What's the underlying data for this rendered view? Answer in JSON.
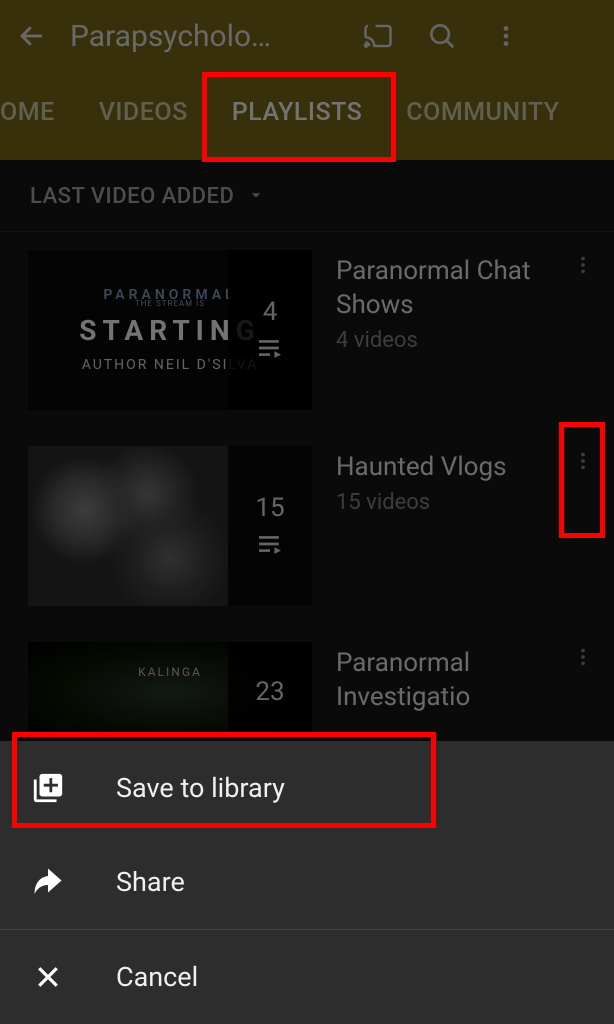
{
  "header": {
    "title": "Parapsycholo…"
  },
  "tabs": {
    "home": "OME",
    "videos": "VIDEOS",
    "playlists": "PLAYLISTS",
    "community": "COMMUNITY"
  },
  "sort": {
    "label": "LAST VIDEO ADDED"
  },
  "playlists": [
    {
      "title": "Paranormal Chat Shows",
      "subtitle": "4 videos",
      "count": "4",
      "thumb_line1": "PARANORMAL",
      "thumb_tiny": "THE STREAM IS",
      "thumb_line2": "STARTING",
      "thumb_line3": "AUTHOR NEIL D'SILVA"
    },
    {
      "title": "Haunted Vlogs",
      "subtitle": "15 videos",
      "count": "15"
    },
    {
      "title": "Paranormal Investigatio",
      "subtitle": "",
      "count": "23",
      "thumb_label": "KALINGA"
    }
  ],
  "sheet": {
    "save": "Save to library",
    "share": "Share",
    "cancel": "Cancel"
  }
}
